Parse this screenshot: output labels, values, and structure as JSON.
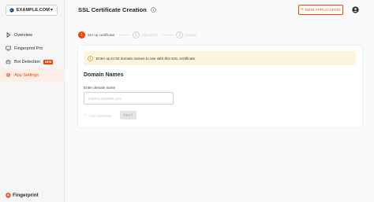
{
  "sidebar": {
    "site_selector": "EXAMPLE.COM",
    "items": [
      {
        "label": "Overview",
        "icon": "monitor-icon"
      },
      {
        "label": "Fingerprint Pro",
        "icon": "computer-icon"
      },
      {
        "label": "Bot Detection",
        "icon": "robot-icon",
        "badge": "NEW"
      },
      {
        "label": "App Settings",
        "icon": "gear-icon",
        "active": true
      }
    ],
    "brand": "Fingerprint"
  },
  "header": {
    "title": "SSL Certificate Creation",
    "new_app_label": "NEW APPLICATION"
  },
  "stepper": {
    "steps": [
      {
        "number": "1",
        "label": "Set up certificate",
        "active": true
      },
      {
        "number": "2",
        "label": "Validation",
        "active": false
      },
      {
        "number": "3",
        "label": "Issued",
        "active": false
      }
    ]
  },
  "card": {
    "alert_text": "Enter up to 50 domain names to use with this SSL certificate",
    "section_title": "Domain Names",
    "field_label": "Enter domain name",
    "field_placeholder": "metrics.yoursite.com",
    "field_value": "",
    "add_domain_label": "ADD DOMAIN",
    "next_label": "NEXT"
  },
  "colors": {
    "accent": "#f04405",
    "alert_bg": "#fdf4dc",
    "active_nav_bg": "#fdeee8"
  }
}
